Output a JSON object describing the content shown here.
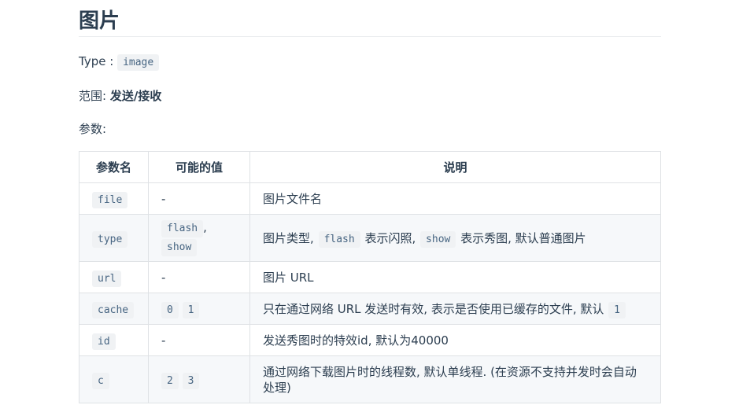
{
  "heading": "图片",
  "type_line": {
    "label": "Type :",
    "value": "image"
  },
  "range_line": {
    "label": "范围:",
    "value": "发送/接收"
  },
  "params_label": "参数:",
  "table": {
    "headers": [
      "参数名",
      "可能的值",
      "说明"
    ],
    "rows": [
      {
        "name": "file",
        "values_text": "-",
        "desc": "图片文件名"
      },
      {
        "name": "type",
        "value_codes": [
          "flash",
          "show"
        ],
        "value_sep": ",",
        "desc_parts": {
          "a": "图片类型,",
          "code1": "flash",
          "b": "表示闪照,",
          "code2": "show",
          "c": "表示秀图, 默认普通图片"
        }
      },
      {
        "name": "url",
        "values_text": "-",
        "desc": "图片 URL"
      },
      {
        "name": "cache",
        "value_codes": [
          "0",
          "1"
        ],
        "desc_parts": {
          "a": "只在通过网络 URL 发送时有效, 表示是否使用已缓存的文件, 默认",
          "code1": "1"
        }
      },
      {
        "name": "id",
        "values_text": "-",
        "desc": "发送秀图时的特效id, 默认为40000"
      },
      {
        "name": "c",
        "value_codes": [
          "2",
          "3"
        ],
        "desc": "通过网络下载图片时的线程数, 默认单线程. (在资源不支持并发时会自动处理)"
      }
    ]
  }
}
